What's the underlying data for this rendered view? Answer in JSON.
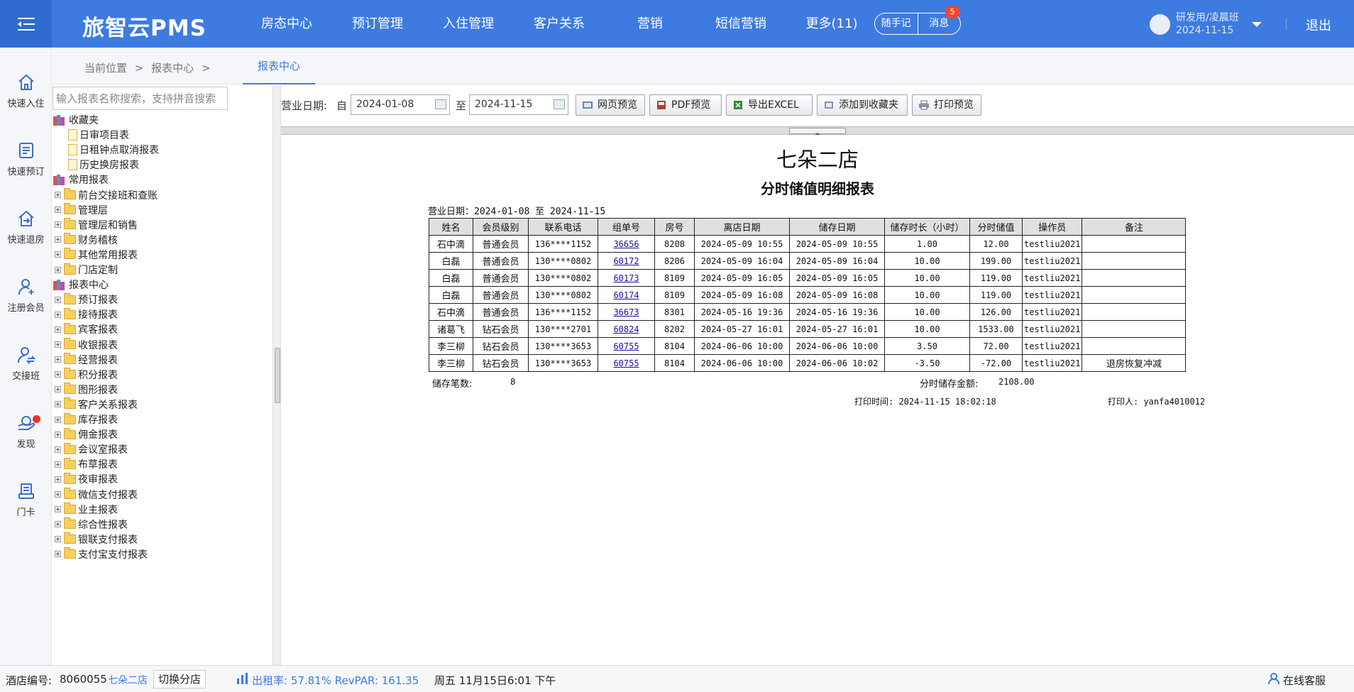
{
  "app": {
    "brand": "旅智云PMS"
  },
  "nav": [
    "房态中心",
    "预订管理",
    "入住管理",
    "客户关系",
    "营销",
    "短信营销",
    "更多(11)"
  ],
  "quick": {
    "memo": "随手记",
    "message": "消息",
    "message_count": "5"
  },
  "user": {
    "name": "研发用/凌晨班",
    "date": "2024-11-15",
    "logout": "退出"
  },
  "sidebar": [
    {
      "label": "快速入住",
      "icon": "home-icon"
    },
    {
      "label": "快速预订",
      "icon": "booking-icon"
    },
    {
      "label": "快速退房",
      "icon": "checkout-icon"
    },
    {
      "label": "注册会员",
      "icon": "add-member-icon"
    },
    {
      "label": "交接班",
      "icon": "shift-handover-icon"
    },
    {
      "label": "发现",
      "icon": "discover-icon"
    },
    {
      "label": "门卡",
      "icon": "door-card-icon"
    }
  ],
  "breadcrumb": {
    "prefix": "当前位置",
    "sep": ">",
    "item": "报表中心",
    "tab": "报表中心"
  },
  "tree": {
    "search_placeholder": "输入报表名称搜索，支持拼音搜索",
    "nodes": [
      {
        "label": "收藏夹",
        "type": "root"
      },
      {
        "label": "日审项目表",
        "type": "doc"
      },
      {
        "label": "日租钟点取消报表",
        "type": "doc"
      },
      {
        "label": "历史换房报表",
        "type": "doc"
      },
      {
        "label": "常用报表",
        "type": "root"
      },
      {
        "label": "前台交接班和查账",
        "type": "folder"
      },
      {
        "label": "管理层",
        "type": "folder"
      },
      {
        "label": "管理层和销售",
        "type": "folder"
      },
      {
        "label": "财务稽核",
        "type": "folder"
      },
      {
        "label": "其他常用报表",
        "type": "folder"
      },
      {
        "label": "门店定制",
        "type": "folder"
      },
      {
        "label": "报表中心",
        "type": "root"
      },
      {
        "label": "预订报表",
        "type": "folder"
      },
      {
        "label": "接待报表",
        "type": "folder"
      },
      {
        "label": "宾客报表",
        "type": "folder"
      },
      {
        "label": "收银报表",
        "type": "folder"
      },
      {
        "label": "经营报表",
        "type": "folder"
      },
      {
        "label": "积分报表",
        "type": "folder"
      },
      {
        "label": "图形报表",
        "type": "folder"
      },
      {
        "label": "客户关系报表",
        "type": "folder"
      },
      {
        "label": "库存报表",
        "type": "folder"
      },
      {
        "label": "佣金报表",
        "type": "folder"
      },
      {
        "label": "会议室报表",
        "type": "folder"
      },
      {
        "label": "布草报表",
        "type": "folder"
      },
      {
        "label": "夜审报表",
        "type": "folder"
      },
      {
        "label": "微信支付报表",
        "type": "folder"
      },
      {
        "label": "业主报表",
        "type": "folder"
      },
      {
        "label": "综合性报表",
        "type": "folder"
      },
      {
        "label": "银联支付报表",
        "type": "folder"
      },
      {
        "label": "支付宝支付报表",
        "type": "folder"
      }
    ]
  },
  "toolbar": {
    "date_label": "营业日期:",
    "from_label": "自",
    "from_value": "2024-01-08",
    "to_label": "至",
    "to_value": "2024-11-15",
    "buttons": [
      "网页预览",
      "PDF预览",
      "导出EXCEL",
      "添加到收藏夹",
      "打印预览"
    ]
  },
  "report": {
    "store": "七朵二店",
    "title": "分时储值明细报表",
    "range": "营业日期：2024-01-08 至 2024-11-15",
    "columns": [
      "姓名",
      "会员级别",
      "联系电话",
      "组单号",
      "房号",
      "离店日期",
      "储存日期",
      "储存时长（小时）",
      "分时储值",
      "操作员",
      "备注"
    ],
    "rows": [
      [
        "石中滴",
        "普通会员",
        "136****1152",
        "36656",
        "8208",
        "2024-05-09 10:55",
        "2024-05-09 10:55",
        "1.00",
        "12.00",
        "testliu2021",
        ""
      ],
      [
        "白磊",
        "普通会员",
        "130****0802",
        "60172",
        "8206",
        "2024-05-09 16:04",
        "2024-05-09 16:04",
        "10.00",
        "199.00",
        "testliu2021",
        ""
      ],
      [
        "白磊",
        "普通会员",
        "130****0802",
        "60173",
        "8109",
        "2024-05-09 16:05",
        "2024-05-09 16:05",
        "10.00",
        "119.00",
        "testliu2021",
        ""
      ],
      [
        "白磊",
        "普通会员",
        "130****0802",
        "60174",
        "8109",
        "2024-05-09 16:08",
        "2024-05-09 16:08",
        "10.00",
        "119.00",
        "testliu2021",
        ""
      ],
      [
        "石中滴",
        "普通会员",
        "136****1152",
        "36673",
        "8301",
        "2024-05-16 19:36",
        "2024-05-16 19:36",
        "10.00",
        "126.00",
        "testliu2021",
        ""
      ],
      [
        "诸葛飞",
        "钻石会员",
        "130****2701",
        "60824",
        "8202",
        "2024-05-27 16:01",
        "2024-05-27 16:01",
        "10.00",
        "1533.00",
        "testliu2021",
        ""
      ],
      [
        "李三柳",
        "钻石会员",
        "130****3653",
        "60755",
        "8104",
        "2024-06-06 10:00",
        "2024-06-06 10:00",
        "3.50",
        "72.00",
        "testliu2021",
        ""
      ],
      [
        "李三柳",
        "钻石会员",
        "130****3653",
        "60755",
        "8104",
        "2024-06-06 10:00",
        "2024-06-06 10:02",
        "-3.50",
        "-72.00",
        "testliu2021",
        "退房恢复冲减"
      ]
    ],
    "count_label": "储存笔数:",
    "count_value": "8",
    "sum_label": "分时储存金额:",
    "sum_value": "2108.00",
    "print_time": "打印时间: 2024-11-15 18:02:18",
    "printer": "打印人: yanfa4010012"
  },
  "status": {
    "hotel_label": "酒店编号:",
    "hotel_no": "8060055",
    "hotel_name": "七朵二店",
    "switch": "切换分店",
    "occupancy": "出租率: 57.81% RevPAR: 161.35",
    "datetime": "周五 11月15日6:01 下午",
    "service": "在线客服"
  }
}
